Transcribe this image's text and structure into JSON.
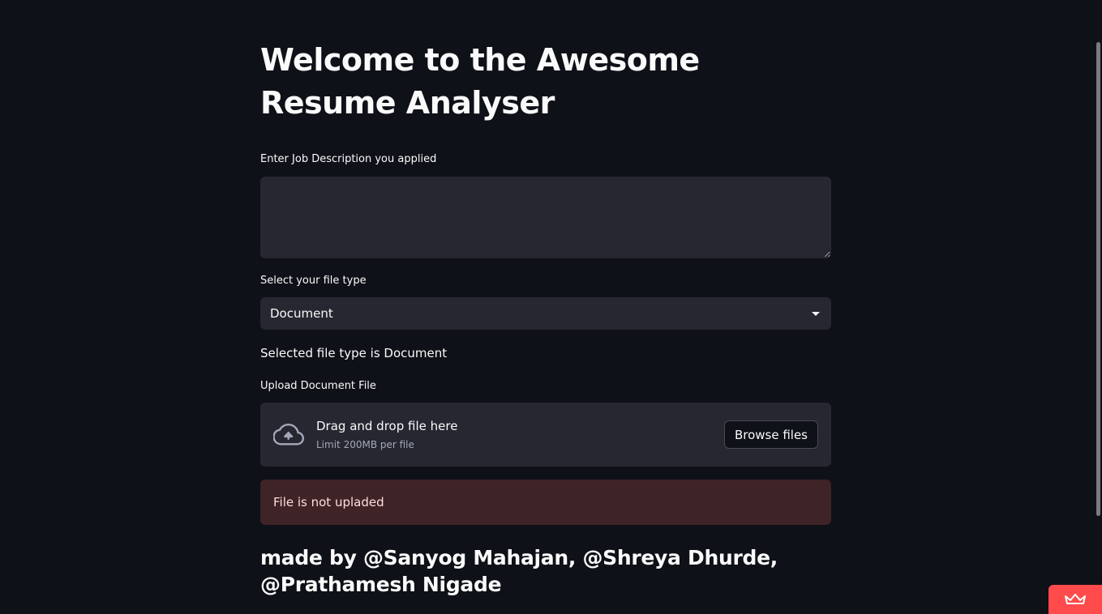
{
  "app": {
    "title": "Welcome to the Awesome Resume Analyser"
  },
  "job_description": {
    "label": "Enter Job Description you applied",
    "value": "",
    "placeholder": ""
  },
  "file_type": {
    "label": "Select your file type",
    "selected": "Document",
    "status": "Selected file type is Document"
  },
  "uploader": {
    "label": "Upload Document File",
    "drop_text": "Drag and drop file here",
    "limit_text": "Limit 200MB per file",
    "browse_label": "Browse files",
    "icon": "cloud-upload-icon"
  },
  "alert": {
    "message": "File is not upladed",
    "color": "#3e2327"
  },
  "footer": {
    "credits": "made by @Sanyog Mahajan, @Shreya Dhurde, @Prathamesh Nigade"
  },
  "colors": {
    "background": "#0e1117",
    "widget": "#262730",
    "accent": "#ff4b4b"
  }
}
